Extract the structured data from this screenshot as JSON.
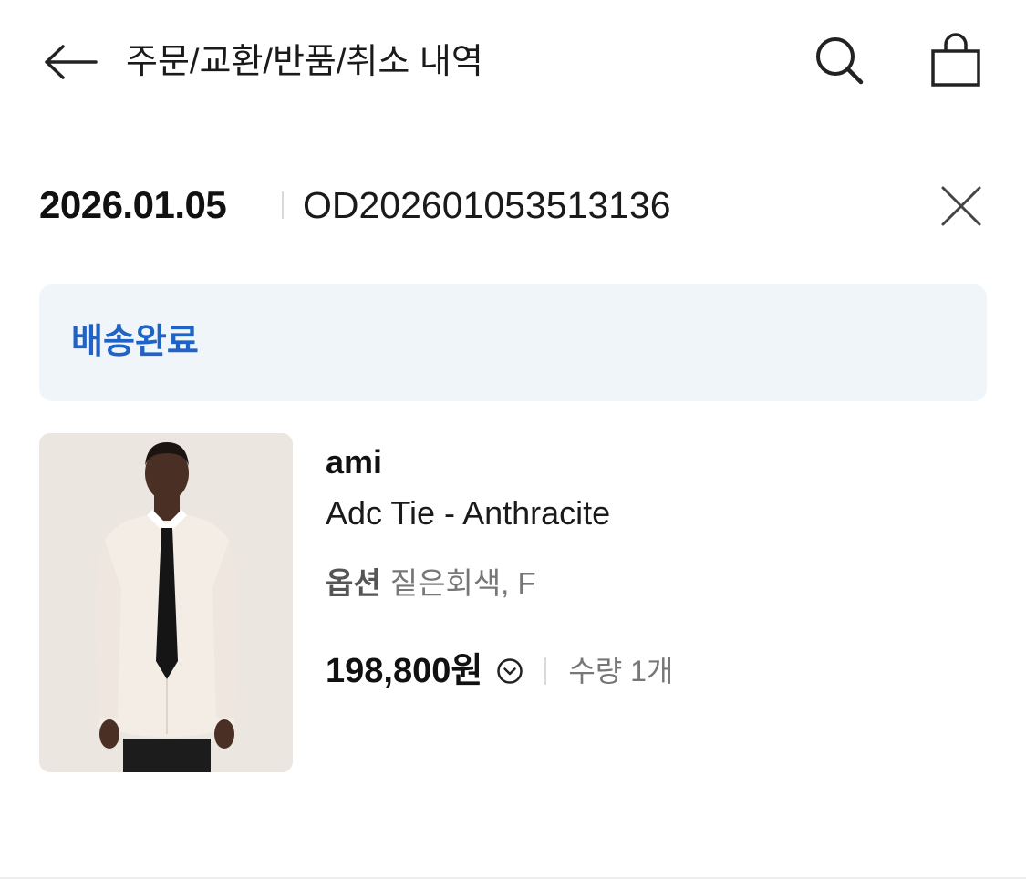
{
  "header": {
    "title": "주문/교환/반품/취소 내역",
    "back_icon": "arrow-left-icon",
    "search_icon": "search-icon",
    "bag_icon": "shopping-bag-icon"
  },
  "order": {
    "date": "2026.01.05",
    "number": "OD202601053513136",
    "close_icon": "close-icon"
  },
  "status": {
    "label": "배송완료",
    "color": "#1f63c6",
    "background": "#f0f5fa"
  },
  "product": {
    "brand": "ami",
    "name": "Adc Tie - Anthracite",
    "option_label": "옵션",
    "option_value": "짙은회색, F",
    "price": "198,800원",
    "price_toggle_icon": "chevron-down-circle-icon",
    "quantity": "수량 1개",
    "image": "product-photo"
  }
}
